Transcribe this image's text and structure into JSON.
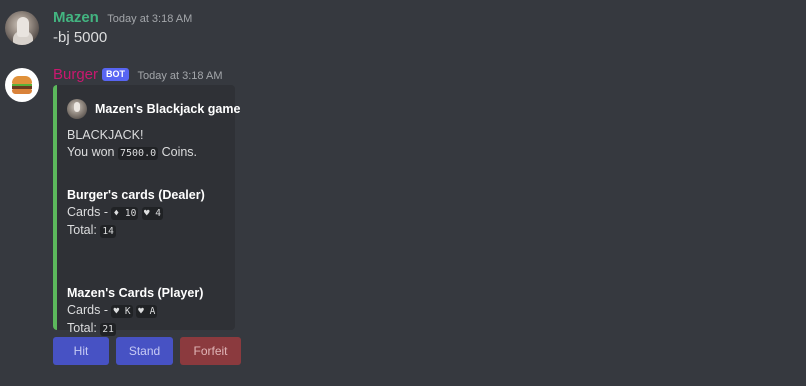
{
  "messages": [
    {
      "author": "Mazen",
      "timestamp": "Today at 3:18 AM",
      "content": "-bj 5000"
    },
    {
      "author": "Burger",
      "bot_tag": "BOT",
      "timestamp": "Today at 3:18 AM",
      "embed": {
        "accent_color": "#5cb85c",
        "author_name": "Mazen's Blackjack game",
        "desc_line1": "BLACKJACK!",
        "desc_line2_prefix": "You won",
        "desc_line2_amount": "7500.0",
        "desc_line2_suffix": "Coins.",
        "dealer": {
          "name": "Burger's cards (Dealer)",
          "cards_label": "Cards -",
          "cards": [
            "♦ 10",
            "♥ 4"
          ],
          "total_label": "Total:",
          "total": "14"
        },
        "player": {
          "name": "Mazen's Cards (Player)",
          "cards_label": "Cards -",
          "cards": [
            "♥ K",
            "♥ A"
          ],
          "total_label": "Total:",
          "total": "21"
        }
      },
      "buttons": [
        {
          "label": "Hit",
          "color": "#4752c4"
        },
        {
          "label": "Stand",
          "color": "#4752c4"
        },
        {
          "label": "Forfeit",
          "color": "#8b3a3e"
        }
      ]
    }
  ]
}
